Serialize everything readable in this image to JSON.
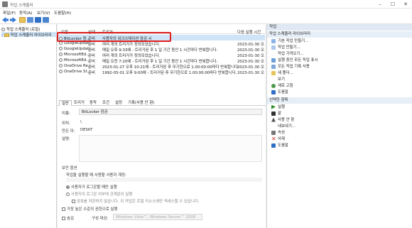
{
  "window": {
    "title": "작업 스케줄러",
    "minimize": "–",
    "maximize": "☐",
    "close": "✕"
  },
  "menu": [
    "파일(F)",
    "동작(A)",
    "보기(V)",
    "도움말(H)"
  ],
  "tree": {
    "root": "작업 스케줄러 (로컬)",
    "library": "작업 스케줄러 라이브러리"
  },
  "table": {
    "headers": [
      "이름",
      "상태",
      "트리거",
      "다음 실행 시간"
    ],
    "rows": [
      {
        "name": "BitLocker 참...",
        "status": "준비",
        "trigger": "사용자의 워크스테이션 잠금 시",
        "next": ""
      },
      {
        "name": "GoogleUpdat...",
        "status": "준비",
        "trigger": "여러 개의 트리거가 정의되었습니다.",
        "next": "2023-01-30 오"
      },
      {
        "name": "GoogleUpdat...",
        "status": "준비",
        "trigger": "매일 오후 9:33에 - 트리거된 후 1 일 기간 동안 1 시간마다 반복합니다.",
        "next": "2023-01-30 오"
      },
      {
        "name": "MicrosoftEd...",
        "status": "준비",
        "trigger": "여러 개의 트리거가 정의되었습니다.",
        "next": "2023-01-30 오"
      },
      {
        "name": "MicrosoftEd...",
        "status": "준비",
        "trigger": "매일 오전 7:20에 - 트리거된 후 1 일 기간 동안 1 시간마다 반복합니다.",
        "next": "2023-01-30 오"
      },
      {
        "name": "OneDrive Re...",
        "status": "준비",
        "trigger": "2023-01-27 오후 10:21에 - 트리거된 후 무기한으로 1.00:00:00마다 반복합니다.",
        "next": "2023-01-30 오"
      },
      {
        "name": "OneDrive St...",
        "status": "준비",
        "trigger": "1992-05-01 오후 9:00에 - 트리거된 후 무기한으로 1.00:00:00마다 반복합니다.",
        "next": "2023-01-30 오"
      }
    ]
  },
  "tabs": [
    "일반",
    "트리거",
    "동작",
    "조건",
    "설정",
    "기록(사용 안 함)"
  ],
  "general": {
    "name_label": "이름:",
    "name_value": "BitLocker 잠금",
    "location_label": "위치:",
    "location_value": "\\",
    "author_label": "만든 이:",
    "author_value": "DESKT",
    "description_label": "설명:",
    "security_header": "보안 옵션",
    "account_text": "작업을 실행할 때 사용할 사용자 계정:",
    "radio_logged_on": "사용자가 로그온할 때만 실행",
    "radio_any": "사용자의 로그온 여부에 관계없이 실행",
    "chk_no_password": "암호를 저장하지 않습니다. 이 작업은 로컬 리소스에만 액세스할 수 있습니다.",
    "chk_highest": "가장 높은 수준의 권한으로 실행",
    "hidden_label": "숨김",
    "configure_label": "구성 대상:",
    "configure_value": "Windows Vista™, Windows Server™ 2008"
  },
  "actions": {
    "header": "작업",
    "library_sub": "작업 스케줄러 라이브러리",
    "library_items": [
      "기본 작업 만들기...",
      "작업 만들기...",
      "작업 가져오기...",
      "실행 중인 모든 작업 표시",
      "모든 작업 기록 사용",
      "새 폴더...",
      "보기",
      "새로 고침",
      "도움말"
    ],
    "selected_sub": "선택한 항목",
    "selected_items": [
      "실행",
      "끝",
      "사용 안 함",
      "내보내기...",
      "속성",
      "삭제",
      "도움말"
    ]
  }
}
